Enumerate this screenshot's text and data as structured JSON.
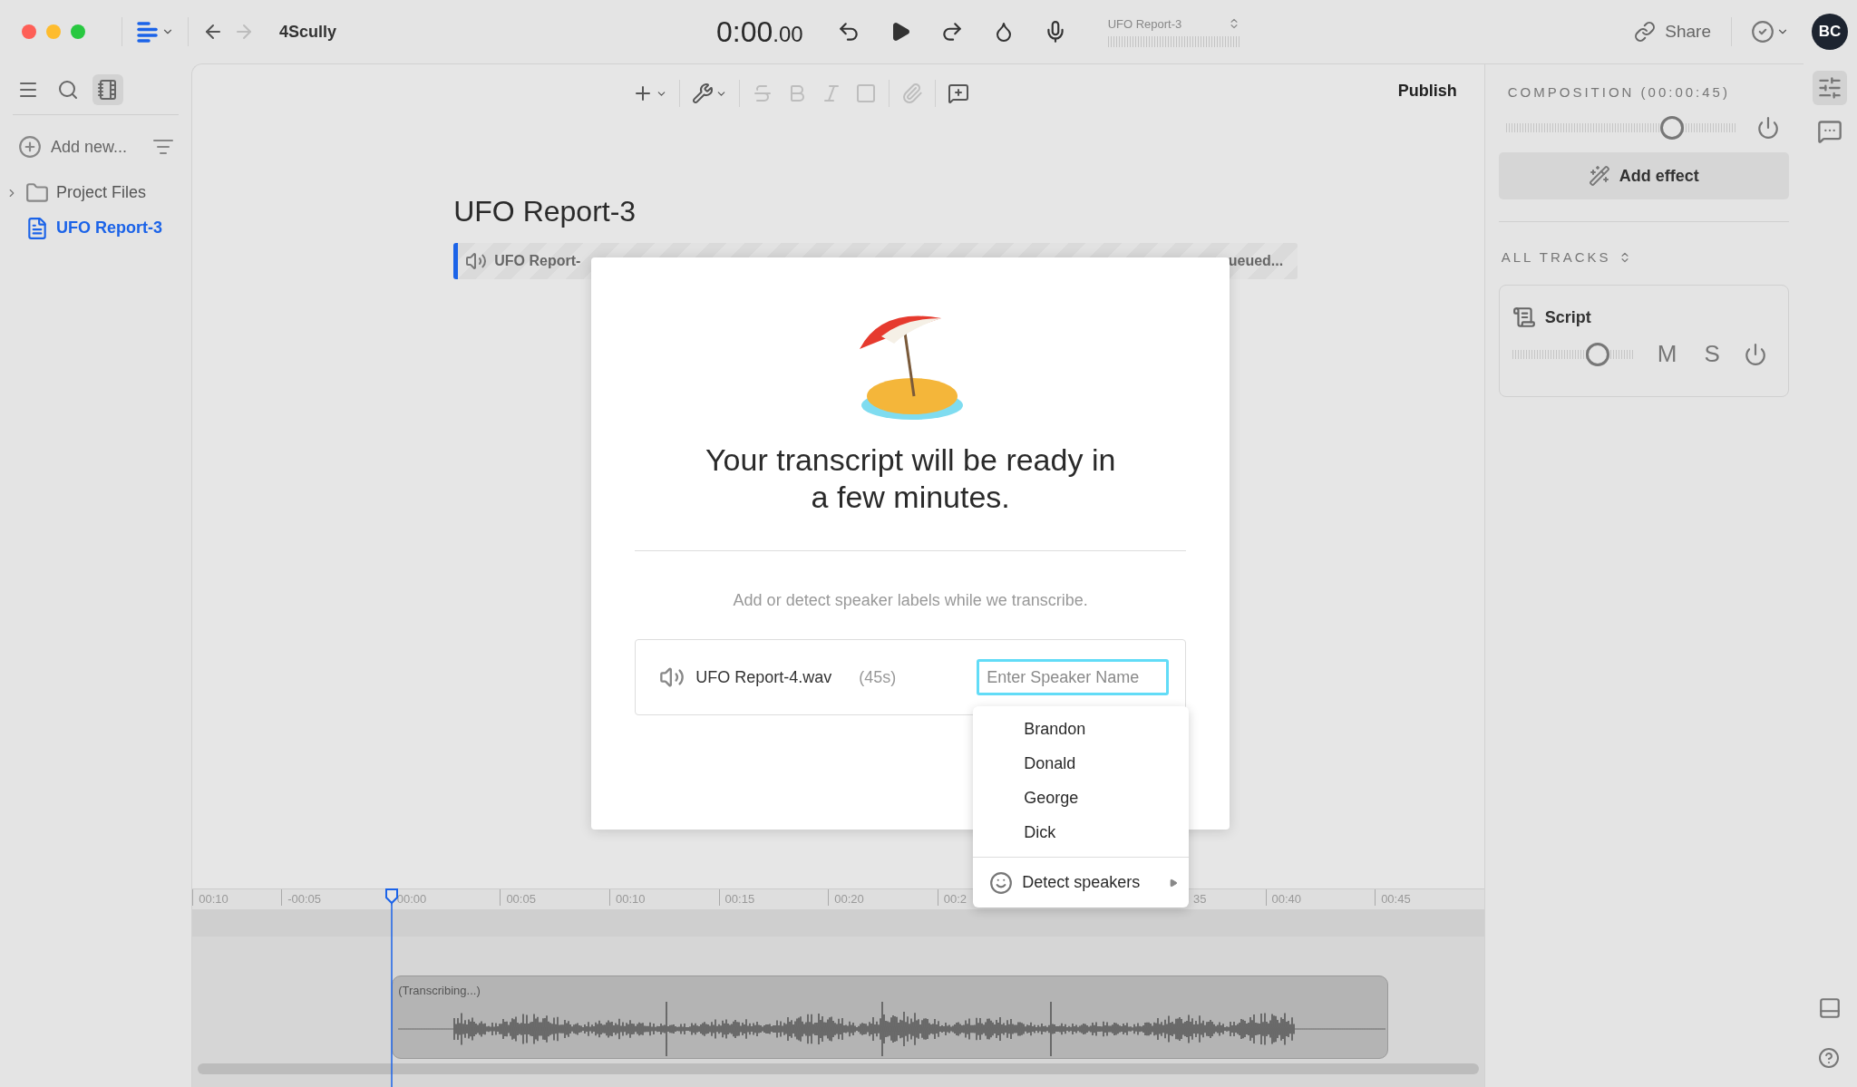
{
  "titlebar": {
    "workspace": "4Scully",
    "time": "0:00",
    "time_fraction": ".00",
    "project": "UFO Report-3",
    "share": "Share",
    "avatar": "BC"
  },
  "sidebar": {
    "tools": [
      {
        "kind": "menu",
        "selected": false
      },
      {
        "kind": "search",
        "selected": false
      },
      {
        "kind": "notebook",
        "selected": true
      }
    ],
    "add_new": "Add new...",
    "items": [
      {
        "label": "Project Files",
        "kind": "folder",
        "selected": false,
        "expanded": false
      },
      {
        "label": "UFO Report-3",
        "kind": "document",
        "selected": true
      }
    ]
  },
  "toolbar": {
    "tools": [
      {
        "kind": "insert",
        "disabled": false
      },
      {
        "kind": "wrench",
        "disabled": false
      },
      {
        "kind": "strikethrough",
        "disabled": true
      },
      {
        "kind": "bold",
        "disabled": true
      },
      {
        "kind": "italic",
        "disabled": true
      },
      {
        "kind": "highlight",
        "disabled": true
      },
      {
        "kind": "attach",
        "disabled": true
      },
      {
        "kind": "comment",
        "disabled": false
      }
    ],
    "publish": "Publish"
  },
  "document": {
    "title": "UFO Report-3",
    "audio_bar": {
      "name": "UFO Report-",
      "status": "ueued..."
    }
  },
  "modal": {
    "heading": "Your transcript will be ready in a few minutes.",
    "subtitle": "Add or detect speaker labels while we transcribe.",
    "file": {
      "name": "UFO Report-4.wav",
      "duration": "(45s)"
    },
    "speaker_field": {
      "placeholder": "Enter Speaker Name",
      "focused": true
    }
  },
  "speaker_menu": {
    "items": [
      "Brandon",
      "Donald",
      "George",
      "Dick"
    ],
    "detect": "Detect speakers"
  },
  "timeline": {
    "ruler": [
      "00:10",
      "-00:05",
      "00:00",
      "00:05",
      "00:10",
      "00:15",
      "00:20",
      "00:2",
      "35",
      "00:40",
      "00:45"
    ],
    "clip": {
      "label": "(Transcribing...)"
    }
  },
  "right_panel": {
    "composition": "COMPOSITION (00:00:45)",
    "volume": {
      "level": 0.72
    },
    "add_effect": "Add effect",
    "tracks_label": "ALL TRACKS",
    "tracks": [
      {
        "name": "Script",
        "level": 0.7,
        "mute": "M",
        "solo": "S"
      }
    ]
  },
  "rail": {
    "items": [
      {
        "kind": "mixer",
        "selected": true
      },
      {
        "kind": "comments",
        "selected": false
      }
    ]
  }
}
